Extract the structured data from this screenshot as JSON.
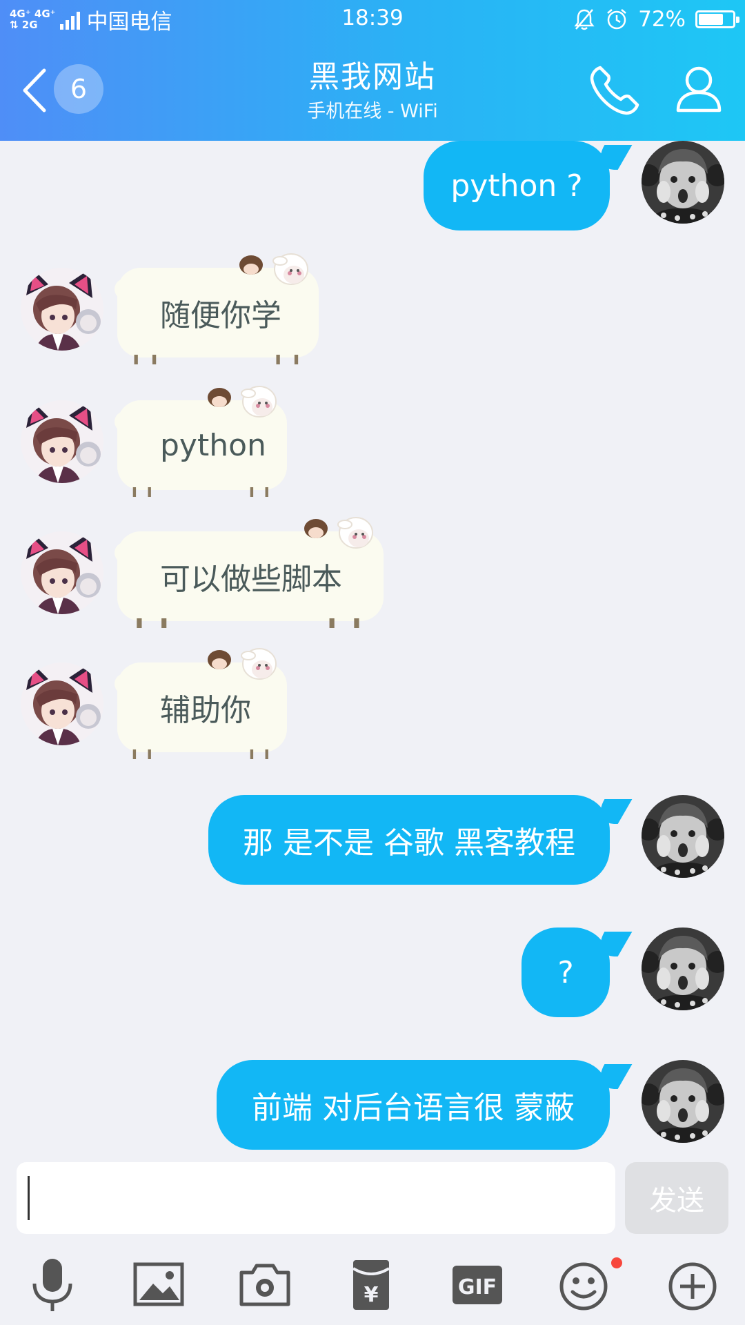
{
  "status_bar": {
    "network_top": "4G⁺ 4G⁺",
    "network_bottom": "⇅  2G",
    "carrier": "中国电信",
    "time": "18:39",
    "battery_percent": "72%",
    "battery_level": 0.72
  },
  "header": {
    "unread_count": "6",
    "title": "黑我网站",
    "subtitle": "手机在线 - WiFi",
    "icons": [
      "back-icon",
      "phone-icon",
      "profile-icon"
    ]
  },
  "messages": [
    {
      "sender": "self",
      "text": "python ?"
    },
    {
      "sender": "other",
      "text": "随便你学"
    },
    {
      "sender": "other",
      "text": "python"
    },
    {
      "sender": "other",
      "text": "可以做些脚本"
    },
    {
      "sender": "other",
      "text": "辅助你"
    },
    {
      "sender": "self",
      "text": "那 是不是 谷歌 黑客教程"
    },
    {
      "sender": "self",
      "text": "?"
    },
    {
      "sender": "self",
      "text": "前端 对后台语言很 蒙蔽"
    }
  ],
  "composer": {
    "value": "",
    "send_label": "发送"
  },
  "toolbar": {
    "icons": [
      "microphone-icon",
      "image-icon",
      "camera-icon",
      "red-packet-icon",
      "gif-icon",
      "emoji-icon",
      "plus-icon"
    ],
    "gif_label": "GIF",
    "red_packet_symbol": "¥"
  },
  "colors": {
    "header_start": "#4f8ef7",
    "header_end": "#1ec7f5",
    "self_bubble": "#12b7f5",
    "other_bubble": "#fbfbf0",
    "background": "#f0f1f6",
    "badge": "#f7473d"
  }
}
